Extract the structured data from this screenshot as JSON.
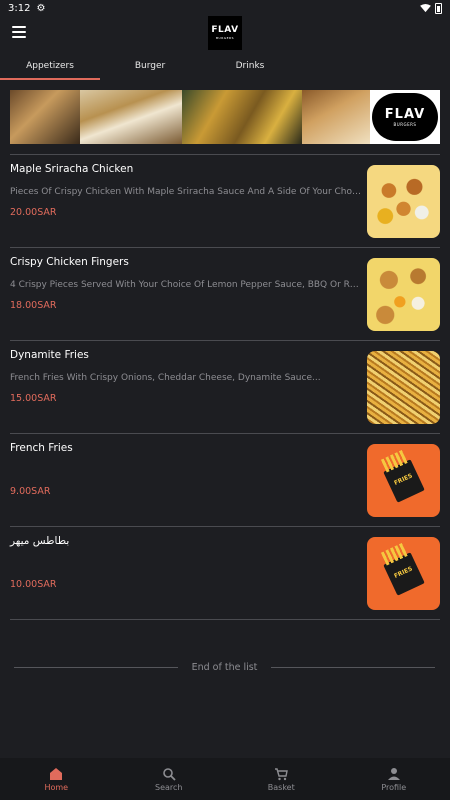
{
  "status": {
    "time": "3:12"
  },
  "header": {
    "logo_text": "FLAV",
    "logo_sub": "BURGERS"
  },
  "tabs": [
    {
      "label": "Appetizers",
      "active": true
    },
    {
      "label": "Burger",
      "active": false
    },
    {
      "label": "Drinks",
      "active": false
    }
  ],
  "banner": {
    "logo_text": "FLAV",
    "logo_sub": "BURGERS"
  },
  "items": [
    {
      "title": "Maple Sriracha Chicken",
      "description": "Pieces Of Crispy Chicken With Maple Sriracha Sauce And A Side Of Your Choice...",
      "price": "20.00SAR",
      "image": "wings"
    },
    {
      "title": "Crispy Chicken Fingers",
      "description": "4 Crispy Pieces Served With Your Choice Of Lemon Pepper Sauce, BBQ Or Ranc...",
      "price": "18.00SAR",
      "image": "fingers"
    },
    {
      "title": "Dynamite Fries",
      "description": "French Fries With Crispy Onions, Cheddar Cheese, Dynamite Sauce...",
      "price": "15.00SAR",
      "image": "dynamite-fries"
    },
    {
      "title": "French Fries",
      "description": "",
      "price": "9.00SAR",
      "image": "fries"
    },
    {
      "title": "بطاطس ميهر",
      "description": "",
      "price": "10.00SAR",
      "image": "fries"
    }
  ],
  "end_of_list": "End of the list",
  "nav": [
    {
      "label": "Home",
      "icon": "home-icon",
      "active": true
    },
    {
      "label": "Search",
      "icon": "search-icon",
      "active": false
    },
    {
      "label": "Basket",
      "icon": "cart-icon",
      "active": false
    },
    {
      "label": "Profile",
      "icon": "person-icon",
      "active": false
    }
  ],
  "colors": {
    "accent": "#e06b5c",
    "background": "#1d1e22",
    "nav_bg": "#17181b"
  }
}
